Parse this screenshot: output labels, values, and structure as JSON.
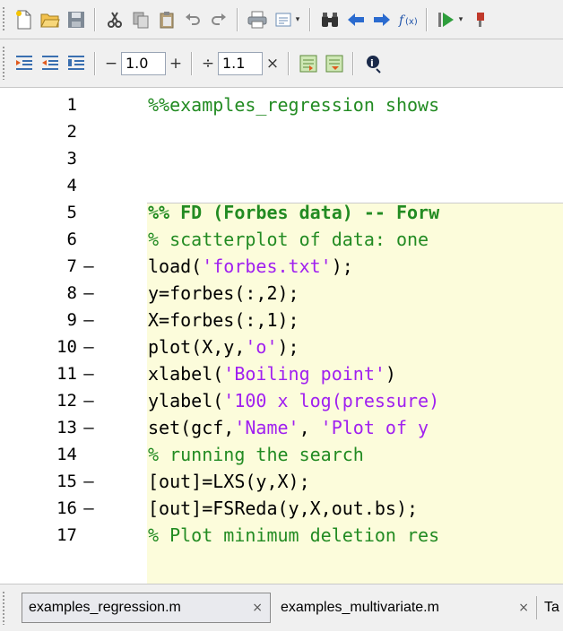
{
  "editor": {
    "lines": [
      {
        "num": "1",
        "exec": false,
        "segs": [
          {
            "t": "%%examples_regression shows",
            "c": "cmt"
          }
        ]
      },
      {
        "num": "2",
        "exec": false,
        "segs": []
      },
      {
        "num": "3",
        "exec": false,
        "segs": []
      },
      {
        "num": "4",
        "exec": false,
        "segs": []
      },
      {
        "num": "5",
        "exec": false,
        "segs": [
          {
            "t": "%% FD (Forbes data) -- Forw",
            "c": "cmt",
            "b": true
          }
        ]
      },
      {
        "num": "6",
        "exec": false,
        "segs": [
          {
            "t": "% scatterplot of data: one",
            "c": "cmt"
          }
        ]
      },
      {
        "num": "7",
        "exec": true,
        "segs": [
          {
            "t": "load(",
            "c": "kw"
          },
          {
            "t": "'forbes.txt'",
            "c": "str"
          },
          {
            "t": ");",
            "c": "kw"
          }
        ]
      },
      {
        "num": "8",
        "exec": true,
        "segs": [
          {
            "t": "y=forbes(:,2);",
            "c": "kw"
          }
        ]
      },
      {
        "num": "9",
        "exec": true,
        "segs": [
          {
            "t": "X=forbes(:,1);",
            "c": "kw"
          }
        ]
      },
      {
        "num": "10",
        "exec": true,
        "segs": [
          {
            "t": "plot(X,y,",
            "c": "kw"
          },
          {
            "t": "'o'",
            "c": "str"
          },
          {
            "t": ");",
            "c": "kw"
          }
        ]
      },
      {
        "num": "11",
        "exec": true,
        "segs": [
          {
            "t": "xlabel(",
            "c": "kw"
          },
          {
            "t": "'Boiling point'",
            "c": "str"
          },
          {
            "t": ")",
            "c": "kw"
          }
        ]
      },
      {
        "num": "12",
        "exec": true,
        "segs": [
          {
            "t": "ylabel(",
            "c": "kw"
          },
          {
            "t": "'100 x log(pressure)",
            "c": "str"
          }
        ]
      },
      {
        "num": "13",
        "exec": true,
        "segs": [
          {
            "t": "set(gcf,",
            "c": "kw"
          },
          {
            "t": "'Name'",
            "c": "str"
          },
          {
            "t": ", ",
            "c": "kw"
          },
          {
            "t": "'Plot of y",
            "c": "str"
          }
        ]
      },
      {
        "num": "14",
        "exec": false,
        "segs": [
          {
            "t": "% running the search",
            "c": "cmt"
          }
        ]
      },
      {
        "num": "15",
        "exec": true,
        "segs": [
          {
            "t": "[out]=LXS(y,X);",
            "c": "kw"
          }
        ]
      },
      {
        "num": "16",
        "exec": true,
        "segs": [
          {
            "t": "[out]=FSReda(y,X,out.bs);",
            "c": "kw"
          }
        ]
      },
      {
        "num": "17",
        "exec": false,
        "segs": [
          {
            "t": "% Plot minimum deletion res",
            "c": "cmt"
          }
        ]
      }
    ],
    "exec_marker": "–"
  },
  "cell_toolbar": {
    "minus": "−",
    "plus": "+",
    "divide": "÷",
    "times": "×",
    "increment_value": "1.0",
    "scale_value": "1.1"
  },
  "tabs": [
    {
      "label": "examples_regression.m",
      "close": "×",
      "active": true
    },
    {
      "label": "examples_multivariate.m",
      "close": "×",
      "active": false
    },
    {
      "label": "Ta",
      "close": "",
      "active": false
    }
  ],
  "colors": {
    "comment": "#228b22",
    "string": "#a020f0",
    "cell_background": "#fcfcdb"
  },
  "icons": [
    "new-file-icon",
    "open-folder-icon",
    "save-icon",
    "cut-icon",
    "copy-icon",
    "paste-icon",
    "undo-icon",
    "redo-icon",
    "print-icon",
    "comment-icon",
    "find-binoculars-icon",
    "back-arrow-icon",
    "forward-arrow-icon",
    "function-icon",
    "run-icon",
    "insert-cell-icon",
    "insert-cell-below-icon",
    "evaluate-cell-icon",
    "evaluate-cell-advance-icon",
    "publish-icon"
  ]
}
